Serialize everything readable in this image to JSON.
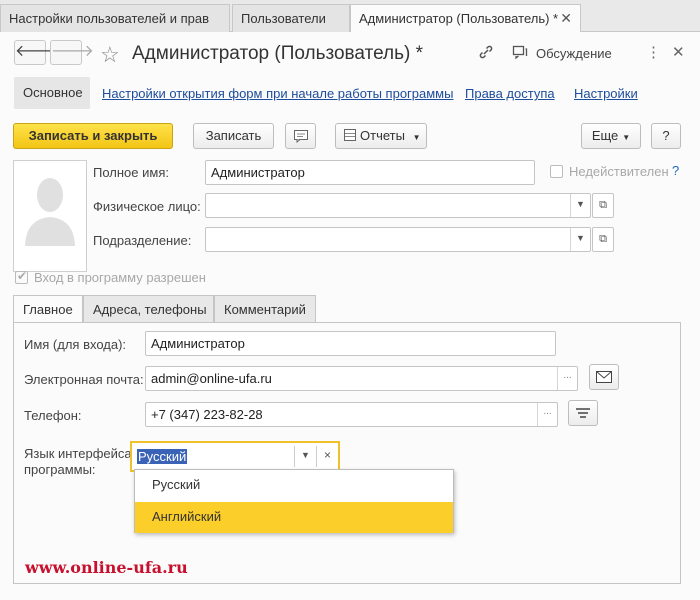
{
  "window_tabs": [
    {
      "label": "Настройки пользователей и прав"
    },
    {
      "label": "Пользователи"
    },
    {
      "label": "Администратор (Пользователь) *",
      "active": true
    }
  ],
  "header": {
    "title": "Администратор (Пользователь) *",
    "discuss_label": "Обсуждение",
    "more_icon": "more-vertical-icon",
    "link_icon": "link-icon",
    "close_icon": "close-icon"
  },
  "sections": {
    "active": "Основное",
    "links": [
      "Настройки открытия форм при начале работы программы",
      "Права доступа",
      "Настройки"
    ]
  },
  "toolbar": {
    "save_close": "Записать и закрыть",
    "save": "Записать",
    "reports": "Отчеты",
    "more": "Еще",
    "help": "?"
  },
  "form": {
    "full_name_label": "Полное имя:",
    "full_name_value": "Администратор",
    "inactive_label": "Недействителен",
    "inactive_help": "?",
    "person_label": "Физическое лицо:",
    "person_value": "",
    "department_label": "Подразделение:",
    "department_value": "",
    "login_allowed_label": "Вход в программу разрешен"
  },
  "form_tabs": [
    "Главное",
    "Адреса, телефоны",
    "Комментарий"
  ],
  "main_tab": {
    "login_name_label": "Имя (для входа):",
    "login_name_value": "Администратор",
    "email_label": "Электронная почта:",
    "email_value": "admin@online-ufa.ru",
    "phone_label": "Телефон:",
    "phone_value": "+7 (347) 223-82-28",
    "language_label_1": "Язык интерфейса",
    "language_label_2": "программы:",
    "language_value": "Русский",
    "language_options": [
      "Русский",
      "Английский"
    ],
    "language_highlighted": "Английский"
  },
  "watermark": "www.online-ufa.ru",
  "colors": {
    "accent": "#f3c516",
    "link": "#1c4c9c",
    "watermark": "#c8102e"
  }
}
